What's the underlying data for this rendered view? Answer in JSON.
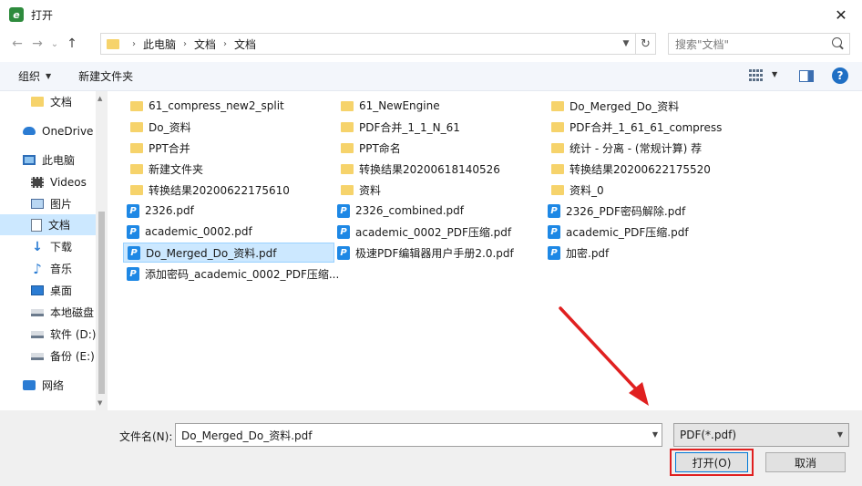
{
  "window": {
    "title": "打开",
    "close_glyph": "✕"
  },
  "nav": {
    "back": "←",
    "forward": "→",
    "recent": "⌄",
    "up": "↑",
    "breadcrumbs": [
      "此电脑",
      "文档",
      "文档"
    ],
    "search_placeholder": "搜索\"文档\""
  },
  "toolbar": {
    "organize": "组织",
    "new_folder": "新建文件夹",
    "help": "?"
  },
  "sidebar": {
    "items": [
      {
        "label": "文档",
        "icon": "folder-icon"
      },
      {
        "label": "OneDrive",
        "icon": "cloud-icon"
      },
      {
        "label": "此电脑",
        "icon": "computer-icon"
      },
      {
        "label": "Videos",
        "icon": "video-icon"
      },
      {
        "label": "图片",
        "icon": "picture-icon"
      },
      {
        "label": "文档",
        "icon": "document-icon",
        "selected": true
      },
      {
        "label": "下载",
        "icon": "download-icon"
      },
      {
        "label": "音乐",
        "icon": "music-icon"
      },
      {
        "label": "桌面",
        "icon": "desktop-icon"
      },
      {
        "label": "本地磁盘",
        "icon": "drive-icon"
      },
      {
        "label": "软件 (D:)",
        "icon": "drive-icon"
      },
      {
        "label": "备份 (E:)",
        "icon": "drive-icon"
      },
      {
        "label": "网络",
        "icon": "network-icon"
      }
    ]
  },
  "files": [
    {
      "name": "61_compress_new2_split",
      "type": "folder"
    },
    {
      "name": "61_NewEngine",
      "type": "folder"
    },
    {
      "name": "Do_Merged_Do_资料",
      "type": "folder"
    },
    {
      "name": "Do_资料",
      "type": "folder"
    },
    {
      "name": "PDF合并_1_1_N_61",
      "type": "folder"
    },
    {
      "name": "PDF合并_1_61_61_compress",
      "type": "folder"
    },
    {
      "name": "PPT合并",
      "type": "folder"
    },
    {
      "name": "PPT命名",
      "type": "folder"
    },
    {
      "name": "统计 - 分离 - (常规计算) 荐",
      "type": "folder"
    },
    {
      "name": "新建文件夹",
      "type": "folder"
    },
    {
      "name": "转换结果20200618140526",
      "type": "folder"
    },
    {
      "name": "转换结果20200622175520",
      "type": "folder"
    },
    {
      "name": "转换结果20200622175610",
      "type": "folder"
    },
    {
      "name": "资料",
      "type": "folder"
    },
    {
      "name": "资料_0",
      "type": "folder"
    },
    {
      "name": "2326.pdf",
      "type": "pdf"
    },
    {
      "name": "2326_combined.pdf",
      "type": "pdf"
    },
    {
      "name": "2326_PDF密码解除.pdf",
      "type": "pdf"
    },
    {
      "name": "academic_0002.pdf",
      "type": "pdf"
    },
    {
      "name": "academic_0002_PDF压缩.pdf",
      "type": "pdf"
    },
    {
      "name": "academic_PDF压缩.pdf",
      "type": "pdf"
    },
    {
      "name": "Do_Merged_Do_资料.pdf",
      "type": "pdf",
      "selected": true
    },
    {
      "name": "极速PDF编辑器用户手册2.0.pdf",
      "type": "pdf"
    },
    {
      "name": "加密.pdf",
      "type": "pdf"
    },
    {
      "name": "添加密码_academic_0002_PDF压缩...",
      "type": "pdf"
    }
  ],
  "footer": {
    "filename_label": "文件名(N):",
    "filename_value": "Do_Merged_Do_资料.pdf",
    "filetype": "PDF(*.pdf)",
    "open_label": "打开(O)",
    "cancel_label": "取消"
  },
  "icons": {
    "pdf_glyph": "P",
    "app_glyph": "e"
  },
  "colors": {
    "selection": "#cce8ff",
    "accent": "#0078d7",
    "highlight": "#e02020",
    "folder": "#f6d36b",
    "pdf": "#1e88e5"
  }
}
